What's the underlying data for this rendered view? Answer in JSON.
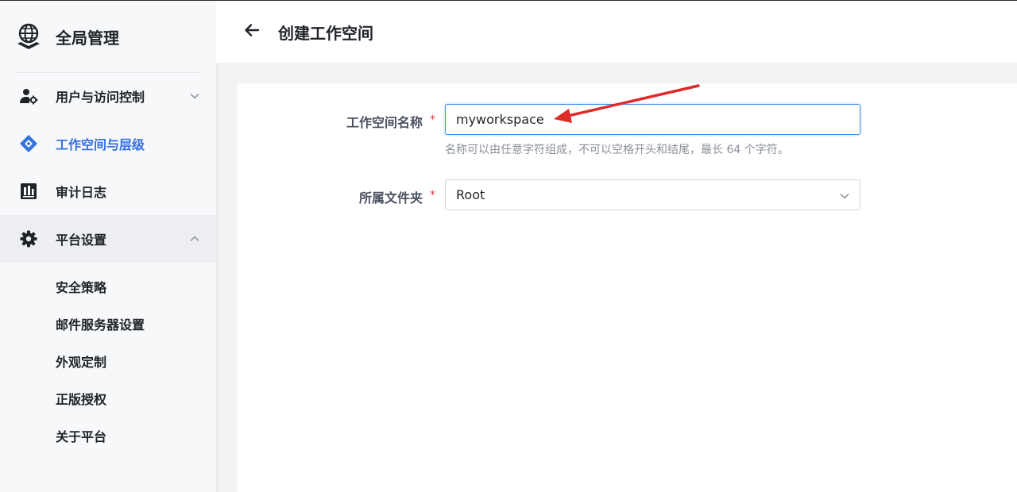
{
  "sidebar": {
    "brand": {
      "title": "全局管理",
      "icon": "globe-icon"
    },
    "items": [
      {
        "label": "用户与访问控制",
        "icon": "user-gear-icon",
        "chevron": "chevron-down-icon"
      },
      {
        "label": "工作空间与层级",
        "icon": "workspace-diamond-icon",
        "active": true
      },
      {
        "label": "审计日志",
        "icon": "audit-chart-icon"
      },
      {
        "label": "平台设置",
        "icon": "gear-icon",
        "chevron": "chevron-up-icon",
        "expanded": true
      }
    ],
    "subitems": [
      {
        "label": "安全策略"
      },
      {
        "label": "邮件服务器设置"
      },
      {
        "label": "外观定制"
      },
      {
        "label": "正版授权"
      },
      {
        "label": "关于平台"
      }
    ]
  },
  "header": {
    "back_icon": "arrow-left-icon",
    "title": "创建工作空间"
  },
  "form": {
    "name": {
      "label": "工作空间名称",
      "required_mark": "*",
      "value": "myworkspace",
      "helper": "名称可以由任意字符组成，不可以空格开头和结尾，最长 64 个字符。"
    },
    "folder": {
      "label": "所属文件夹",
      "required_mark": "*",
      "value": "Root"
    }
  },
  "colors": {
    "accent": "#3370e0",
    "required": "#e03e3e",
    "annotation_arrow": "#e02b2b",
    "focus_border": "#3d8bf0"
  }
}
